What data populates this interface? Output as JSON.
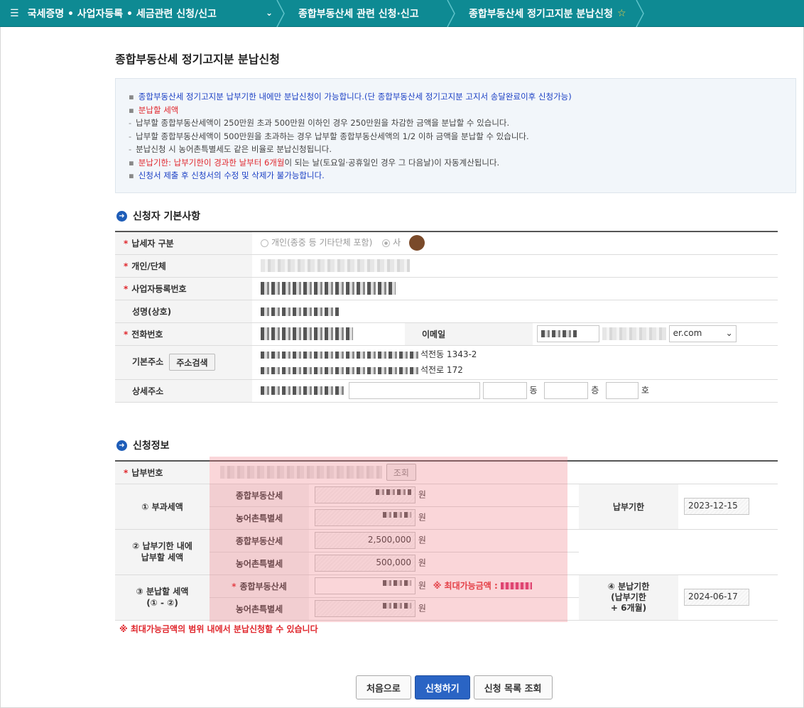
{
  "topbar": {
    "menu_label": "국세증명 • 사업자등록 • 세금관련 신청/신고",
    "crumb1": "종합부동산세 관련 신청·신고",
    "crumb2": "종합부동산세 정기고지분 분납신청"
  },
  "title": "종합부동산세 정기고지분 분납신청",
  "notice": {
    "line1": "종합부동산세 정기고지분 납부기한 내에만 분납신청이 가능합니다.(단 종합부동산세 정기고지분 고지서 송달완료이후 신청가능)",
    "line2": "분납할 세액",
    "line3": "납부할 종합부동산세액이 250만원 초과 500만원 이하인 경우 250만원을 차감한 금액을 분납할 수 있습니다.",
    "line4": "납부할 종합부동산세액이 500만원을 초과하는 경우 납부할 종합부동산세액의 1/2 이하 금액을 분납할 수 있습니다.",
    "line5": "분납신청 시 농어촌특별세도 같은 비율로 분납신청됩니다.",
    "line6_red": "분납기한: 납부기한이 경과한 날부터 6개월",
    "line6_rest": "이 되는 날(토요일·공휴일인 경우 그 다음날)이 자동계산됩니다.",
    "line7": "신청서 제출 후 신청서의 수정 및 삭제가 불가능합니다."
  },
  "applicant": {
    "heading": "신청자 기본사항",
    "taxpayer_type_label": "납세자 구분",
    "opt_individual": "개인(종중 등 기타단체 포함)",
    "opt_business": "사",
    "indiv_org_label": "개인/단체",
    "bizno_label": "사업자등록번호",
    "name_label": "성명(상호)",
    "phone_label": "전화번호",
    "email_label": "이메일",
    "email_domain": "er.com",
    "address_label": "기본주소",
    "address_search": "주소검색",
    "addr_jibun_tail": "석전동 1343-2",
    "addr_road_tail": "석전로 172",
    "detail_label": "상세주소",
    "dong": "동",
    "floor": "층",
    "ho": "호"
  },
  "application": {
    "heading": "신청정보",
    "payment_no_label": "납부번호",
    "lookup_btn": "조회",
    "row1_label": "① 부과세액",
    "row2_label_a": "② 납부기한 내에",
    "row2_label_b": "납부할 세액",
    "row3_label_a": "③ 분납할 세액",
    "row3_label_b": "(① - ②)",
    "tax1": "종합부동산세",
    "tax2": "농어촌특별세",
    "won": "원",
    "due_label": "납부기한",
    "due_value": "2023-12-15",
    "pay_comprehensive": "2,500,000",
    "pay_rural": "500,000",
    "max_label": "※ 최대가능금액 :",
    "install_due_label_a": "④ 분납기한",
    "install_due_label_b": "(납부기한",
    "install_due_label_c": "+ 6개월)",
    "install_due_value": "2024-06-17",
    "warn": "※ 최대가능금액의 범위 내에서 분납신청할 수 있습니다"
  },
  "buttons": {
    "home": "처음으로",
    "apply": "신청하기",
    "list": "신청 목록 조회"
  }
}
